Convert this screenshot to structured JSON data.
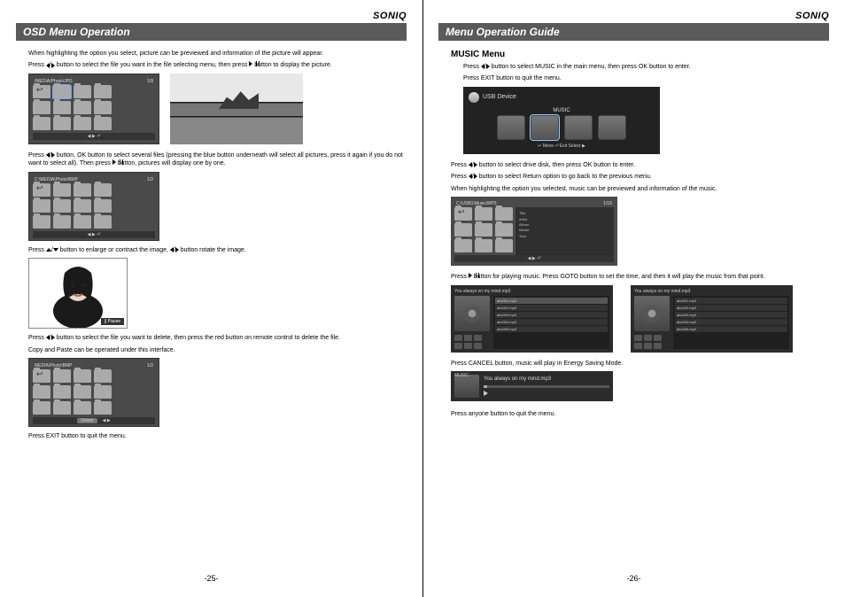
{
  "brand": "SONIQ",
  "left": {
    "header": "OSD Menu Operation",
    "p1a": "When highlighting the option you select, picture can be previewed and information of the picture will appear.",
    "p1b": "Press ◀/▶ button to select the file you want in the file selecting menu, then press ▶∥ button to display the picture.",
    "fig1_path": "/MEDIA/Photo\\JPG",
    "fig1_count": "1/9",
    "p2": "Press ◀/▶ button, OK button to select several files (pressing the blue button underneath will select all pictures, press it again if you do not want to select all). Then press ▶∥ button, pictures will display one by one.",
    "fig2_path": "C:\\MEDIA\\Photo\\BMP",
    "fig2_count": "1/2",
    "p3": "Press ▲/▼ button to enlarge or contract the image, ◀/▶ button rotate the image.",
    "pause_badge": "∥ Pause",
    "p4a": "Press ◀/▶ button to select the file you want to delete, then press the red button on remote control to delete the file.",
    "p4b": "Copy and Paste can be operated under this interface.",
    "fig4_path": "MEDIA\\Photo\\BMP",
    "fig4_count": "1/2",
    "fig4_bar_delete": "Delete",
    "p5": "Press EXIT button to quit the menu.",
    "pagenum": "-25-"
  },
  "right": {
    "header": "Menu Operation Guide",
    "section": "MUSIC Menu",
    "p1a": "Press ◀/▶ button to select MUSIC in the main menu, then press OK button to enter.",
    "p1b": "Press EXIT button to quit the menu.",
    "usb_title": "USB Device",
    "usb_label": "MUSIC",
    "usb_bar": "↩ Move   ⏎ Exit   Select ▶",
    "p2a": "Press ◀/▶ button to select drive disk, then press OK button to enter.",
    "p2b": "Press ◀/▶ button to select Return option to go back to the previous menu.",
    "p2c": "When highlighting the option you selected, music can be previewed and information of the music.",
    "mg_path": "C:\\USB1\\Music\\MP3",
    "mg_count": "1/15",
    "p3": "Press ▶∥ button for playing music. Press GOTO button to set the time, and then it will play the music from that point.",
    "player_title": "You always on my mind.mp3",
    "tracks": [
      "abc001.mp3",
      "abc002.mp3",
      "abc003.mp3",
      "abc004.mp3",
      "abc005.mp3"
    ],
    "p4": "Press CANCEL button, music will play in Energy Saving Mode.",
    "mini_label": "MUSIC",
    "mini_title": "You always on my mind.mp3",
    "p5": "Press anyone button to quit the menu.",
    "pagenum": "-26-"
  }
}
